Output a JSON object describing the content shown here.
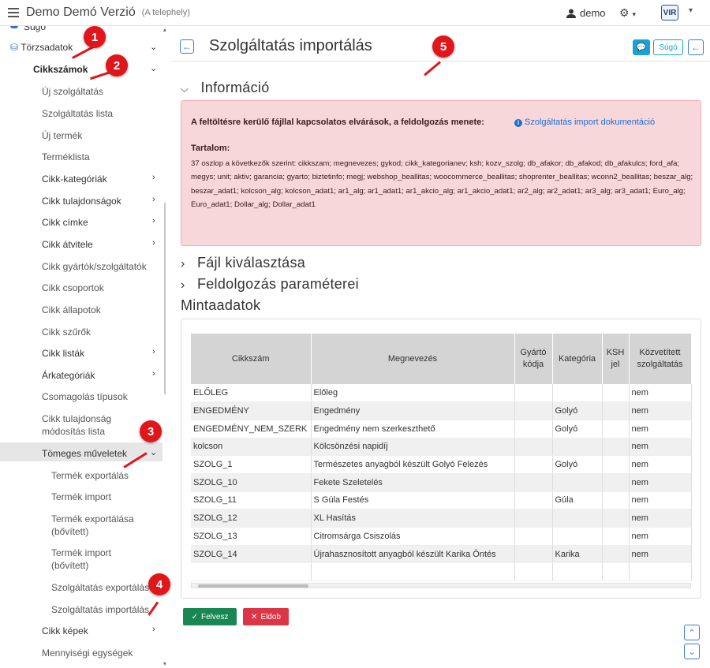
{
  "topbar": {
    "app_title": "Demo Demó Verzió",
    "app_subtitle": "(A telephely)",
    "user": "demo",
    "logo": "VIR"
  },
  "sidebar": {
    "items": [
      {
        "label": "Súgó"
      },
      {
        "label": "Törzsadatok"
      },
      {
        "label": "Cikkszámok"
      },
      {
        "label": "Új szolgáltatás"
      },
      {
        "label": "Szolgáltatás lista"
      },
      {
        "label": "Új termék"
      },
      {
        "label": "Terméklista"
      },
      {
        "label": "Cikk-kategóriák"
      },
      {
        "label": "Cikk tulajdonságok"
      },
      {
        "label": "Cikk címke"
      },
      {
        "label": "Cikk átvitele"
      },
      {
        "label": "Cikk gyártók/szolgáltatók"
      },
      {
        "label": "Cikk csoportok"
      },
      {
        "label": "Cikk állapotok"
      },
      {
        "label": "Cikk szűrők"
      },
      {
        "label": "Cikk listák"
      },
      {
        "label": "Árkategóriák"
      },
      {
        "label": "Csomagolás típusok"
      },
      {
        "label": "Cikk tulajdonság"
      },
      {
        "label": "módosítás lista"
      },
      {
        "label": "Tömeges műveletek"
      },
      {
        "label": "Termék exportálás"
      },
      {
        "label": "Termék import"
      },
      {
        "label": "Termék exportálása"
      },
      {
        "label": "(bővített)"
      },
      {
        "label": "Termék import"
      },
      {
        "label": "(bővített)"
      },
      {
        "label": "Szolgáltatás exportálás"
      },
      {
        "label": "Szolgáltatás importálás"
      },
      {
        "label": "Cikk képek"
      },
      {
        "label": "Mennyiségi egységek"
      }
    ]
  },
  "page": {
    "title": "Szolgáltatás importálás",
    "help_label": "Súgó",
    "info_section": "Információ",
    "info_requirements": "A feltöltésre kerülő fájllal kapcsolatos elvárások, a feldolgozás menete:",
    "info_link": "Szolgáltatás import dokumentáció",
    "info_content_title": "Tartalom:",
    "info_content_text": "37 oszlop a következők szerint: cikkszam; megnevezes; gykod; cikk_kategorianev; ksh; kozv_szolg; db_afakor; db_afakod; db_afakulcs; ford_afa; megys; unit; aktiv; garancia; gyarto; biztetinfo; megj; webshop_beallitas; woocommerce_beallitas; shoprenter_beallitas; wconn2_beallitas; beszar_alg; beszar_adat1; kolcson_alg; kolcson_adat1; ar1_alg; ar1_adat1; ar1_akcio_alg; ar1_akcio_adat1; ar2_alg; ar2_adat1; ar3_alg; ar3_adat1; Euro_alg; Euro_adat1; Dollar_alg; Dollar_adat1",
    "file_section": "Fájl kiválasztása",
    "params_section": "Feldolgozás paraméterei",
    "sample_section": "Mintaadatok",
    "add_label": "Felvesz",
    "delete_label": "Eldob"
  },
  "table": {
    "headers": [
      "Cikkszám",
      "Megnevezés",
      "Gyártó\nkódja",
      "Kategória",
      "KSH\njel",
      "Közvetített\nszolgáltatás"
    ],
    "rows": [
      [
        "ELŐLEG",
        "Előleg",
        "",
        "",
        "",
        "nem"
      ],
      [
        "ENGEDMÉNY",
        "Engedmény",
        "",
        "Golyó",
        "",
        "nem"
      ],
      [
        "ENGEDMÉNY_NEM_SZERK",
        "Engedmény nem szerkeszthető",
        "",
        "Golyó",
        "",
        "nem"
      ],
      [
        "kolcson",
        "Kölcsönzési napidíj",
        "",
        "",
        "",
        "nem"
      ],
      [
        "SZOLG_1",
        "Természetes anyagból készült Golyó Felezés",
        "",
        "Golyó",
        "",
        "nem"
      ],
      [
        "SZOLG_10",
        "Fekete Szeletelés",
        "",
        "",
        "",
        "nem"
      ],
      [
        "SZOLG_11",
        "S Gúla Festés",
        "",
        "Gúla",
        "",
        "nem"
      ],
      [
        "SZOLG_12",
        "XL Hasítás",
        "",
        "",
        "",
        "nem"
      ],
      [
        "SZOLG_13",
        "Citromsárga Csiszolás",
        "",
        "",
        "",
        "nem"
      ],
      [
        "SZOLG_14",
        "Újrahasznosított anyagból készült Karika Öntés",
        "",
        "Karika",
        "",
        "nem"
      ]
    ]
  },
  "annotations": [
    "1",
    "2",
    "3",
    "4",
    "5"
  ],
  "colors": {
    "badge": "#e0161a",
    "info_bg": "#f8d7da",
    "add": "#198754",
    "delete": "#dc3545",
    "link": "#1a6fd0"
  }
}
